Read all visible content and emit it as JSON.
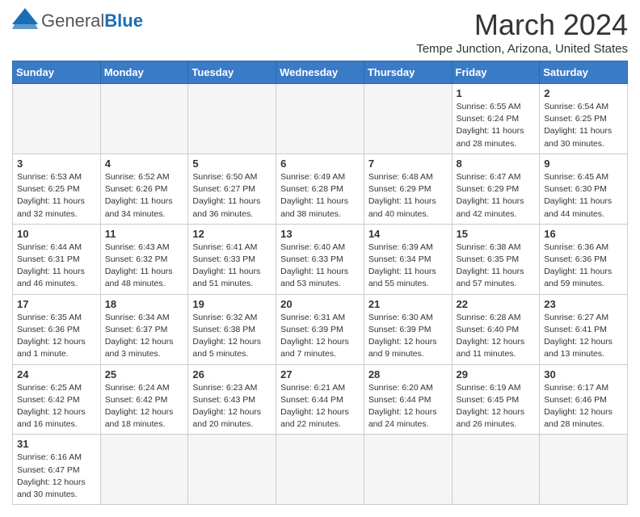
{
  "header": {
    "logo_general": "General",
    "logo_blue": "Blue",
    "month_title": "March 2024",
    "location": "Tempe Junction, Arizona, United States"
  },
  "days_of_week": [
    "Sunday",
    "Monday",
    "Tuesday",
    "Wednesday",
    "Thursday",
    "Friday",
    "Saturday"
  ],
  "weeks": [
    [
      {
        "day": "",
        "info": ""
      },
      {
        "day": "",
        "info": ""
      },
      {
        "day": "",
        "info": ""
      },
      {
        "day": "",
        "info": ""
      },
      {
        "day": "",
        "info": ""
      },
      {
        "day": "1",
        "info": "Sunrise: 6:55 AM\nSunset: 6:24 PM\nDaylight: 11 hours\nand 28 minutes."
      },
      {
        "day": "2",
        "info": "Sunrise: 6:54 AM\nSunset: 6:25 PM\nDaylight: 11 hours\nand 30 minutes."
      }
    ],
    [
      {
        "day": "3",
        "info": "Sunrise: 6:53 AM\nSunset: 6:25 PM\nDaylight: 11 hours\nand 32 minutes."
      },
      {
        "day": "4",
        "info": "Sunrise: 6:52 AM\nSunset: 6:26 PM\nDaylight: 11 hours\nand 34 minutes."
      },
      {
        "day": "5",
        "info": "Sunrise: 6:50 AM\nSunset: 6:27 PM\nDaylight: 11 hours\nand 36 minutes."
      },
      {
        "day": "6",
        "info": "Sunrise: 6:49 AM\nSunset: 6:28 PM\nDaylight: 11 hours\nand 38 minutes."
      },
      {
        "day": "7",
        "info": "Sunrise: 6:48 AM\nSunset: 6:29 PM\nDaylight: 11 hours\nand 40 minutes."
      },
      {
        "day": "8",
        "info": "Sunrise: 6:47 AM\nSunset: 6:29 PM\nDaylight: 11 hours\nand 42 minutes."
      },
      {
        "day": "9",
        "info": "Sunrise: 6:45 AM\nSunset: 6:30 PM\nDaylight: 11 hours\nand 44 minutes."
      }
    ],
    [
      {
        "day": "10",
        "info": "Sunrise: 6:44 AM\nSunset: 6:31 PM\nDaylight: 11 hours\nand 46 minutes."
      },
      {
        "day": "11",
        "info": "Sunrise: 6:43 AM\nSunset: 6:32 PM\nDaylight: 11 hours\nand 48 minutes."
      },
      {
        "day": "12",
        "info": "Sunrise: 6:41 AM\nSunset: 6:33 PM\nDaylight: 11 hours\nand 51 minutes."
      },
      {
        "day": "13",
        "info": "Sunrise: 6:40 AM\nSunset: 6:33 PM\nDaylight: 11 hours\nand 53 minutes."
      },
      {
        "day": "14",
        "info": "Sunrise: 6:39 AM\nSunset: 6:34 PM\nDaylight: 11 hours\nand 55 minutes."
      },
      {
        "day": "15",
        "info": "Sunrise: 6:38 AM\nSunset: 6:35 PM\nDaylight: 11 hours\nand 57 minutes."
      },
      {
        "day": "16",
        "info": "Sunrise: 6:36 AM\nSunset: 6:36 PM\nDaylight: 11 hours\nand 59 minutes."
      }
    ],
    [
      {
        "day": "17",
        "info": "Sunrise: 6:35 AM\nSunset: 6:36 PM\nDaylight: 12 hours\nand 1 minute."
      },
      {
        "day": "18",
        "info": "Sunrise: 6:34 AM\nSunset: 6:37 PM\nDaylight: 12 hours\nand 3 minutes."
      },
      {
        "day": "19",
        "info": "Sunrise: 6:32 AM\nSunset: 6:38 PM\nDaylight: 12 hours\nand 5 minutes."
      },
      {
        "day": "20",
        "info": "Sunrise: 6:31 AM\nSunset: 6:39 PM\nDaylight: 12 hours\nand 7 minutes."
      },
      {
        "day": "21",
        "info": "Sunrise: 6:30 AM\nSunset: 6:39 PM\nDaylight: 12 hours\nand 9 minutes."
      },
      {
        "day": "22",
        "info": "Sunrise: 6:28 AM\nSunset: 6:40 PM\nDaylight: 12 hours\nand 11 minutes."
      },
      {
        "day": "23",
        "info": "Sunrise: 6:27 AM\nSunset: 6:41 PM\nDaylight: 12 hours\nand 13 minutes."
      }
    ],
    [
      {
        "day": "24",
        "info": "Sunrise: 6:25 AM\nSunset: 6:42 PM\nDaylight: 12 hours\nand 16 minutes."
      },
      {
        "day": "25",
        "info": "Sunrise: 6:24 AM\nSunset: 6:42 PM\nDaylight: 12 hours\nand 18 minutes."
      },
      {
        "day": "26",
        "info": "Sunrise: 6:23 AM\nSunset: 6:43 PM\nDaylight: 12 hours\nand 20 minutes."
      },
      {
        "day": "27",
        "info": "Sunrise: 6:21 AM\nSunset: 6:44 PM\nDaylight: 12 hours\nand 22 minutes."
      },
      {
        "day": "28",
        "info": "Sunrise: 6:20 AM\nSunset: 6:44 PM\nDaylight: 12 hours\nand 24 minutes."
      },
      {
        "day": "29",
        "info": "Sunrise: 6:19 AM\nSunset: 6:45 PM\nDaylight: 12 hours\nand 26 minutes."
      },
      {
        "day": "30",
        "info": "Sunrise: 6:17 AM\nSunset: 6:46 PM\nDaylight: 12 hours\nand 28 minutes."
      }
    ],
    [
      {
        "day": "31",
        "info": "Sunrise: 6:16 AM\nSunset: 6:47 PM\nDaylight: 12 hours\nand 30 minutes."
      },
      {
        "day": "",
        "info": ""
      },
      {
        "day": "",
        "info": ""
      },
      {
        "day": "",
        "info": ""
      },
      {
        "day": "",
        "info": ""
      },
      {
        "day": "",
        "info": ""
      },
      {
        "day": "",
        "info": ""
      }
    ]
  ]
}
